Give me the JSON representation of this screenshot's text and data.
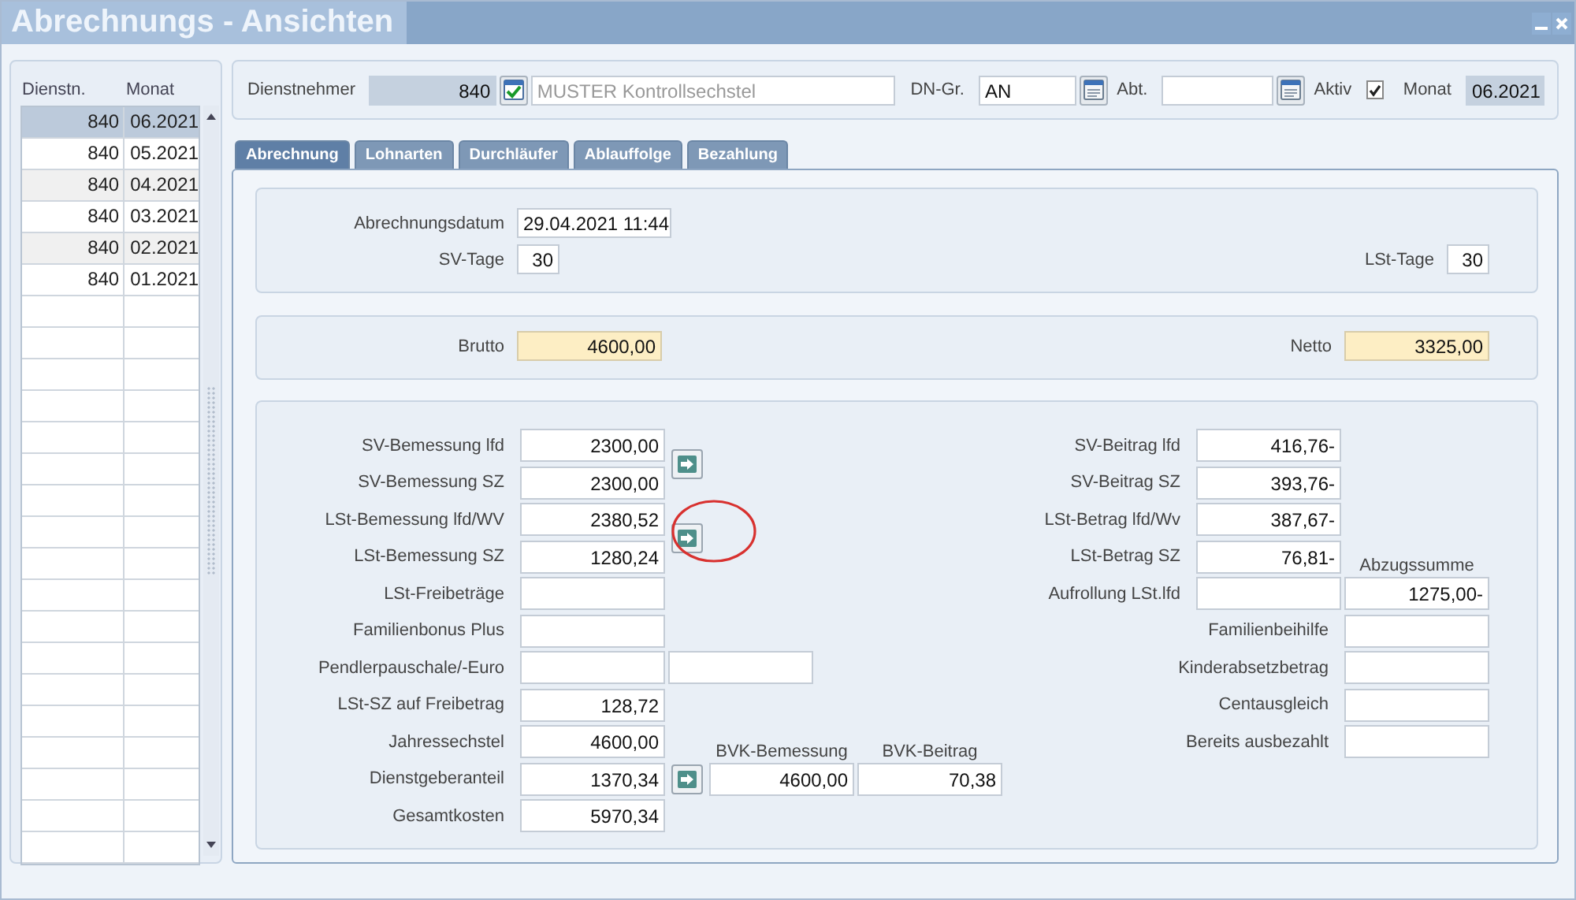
{
  "window": {
    "title": "Abrechnungs - Ansichten"
  },
  "list": {
    "columns": [
      "Dienstn.",
      "Monat"
    ],
    "rows": [
      {
        "number": "840",
        "month": "06.2021",
        "selected": true
      },
      {
        "number": "840",
        "month": "05.2021",
        "selected": false
      },
      {
        "number": "840",
        "month": "04.2021",
        "selected": false
      },
      {
        "number": "840",
        "month": "03.2021",
        "selected": false
      },
      {
        "number": "840",
        "month": "02.2021",
        "selected": false
      },
      {
        "number": "840",
        "month": "01.2021",
        "selected": false
      }
    ]
  },
  "header": {
    "employee_label": "Dienstnehmer",
    "employee_number": "840",
    "employee_name": "MUSTER Kontrollsechstel",
    "group_label": "DN-Gr.",
    "group_value": "AN",
    "dept_label": "Abt.",
    "active_label": "Aktiv",
    "active_checked": true,
    "month_label": "Monat",
    "month_value": "06.2021"
  },
  "tabs": [
    {
      "label": "Abrechnung",
      "selected": true
    },
    {
      "label": "Lohnarten",
      "selected": false
    },
    {
      "label": "Durchläufer",
      "selected": false
    },
    {
      "label": "Ablauffolge",
      "selected": false
    },
    {
      "label": "Bezahlung",
      "selected": false
    }
  ],
  "dates": {
    "date_label": "Abrechnungsdatum",
    "date_value": "29.04.2021 11:44",
    "sv_days_label": "SV-Tage",
    "sv_days": "30",
    "lst_days_label": "LSt-Tage",
    "lst_days": "30"
  },
  "totals": {
    "gross_label": "Brutto",
    "gross": "4600,00",
    "net_label": "Netto",
    "net": "3325,00"
  },
  "rows": [
    {
      "label": "SV-Bemessung lfd",
      "value": "2300,00",
      "arrow": {
        "kind": "between"
      },
      "right": {
        "kind": "main",
        "label": "SV-Beitrag lfd",
        "value": "416,76-"
      }
    },
    {
      "label": "SV-Bemessung SZ",
      "value": "2300,00",
      "right": {
        "kind": "main",
        "label": "SV-Beitrag SZ",
        "value": "393,76-"
      }
    },
    {
      "label": "LSt-Bemessung lfd/WV",
      "value": "2380,52",
      "arrow": {
        "kind": "between",
        "highlighted": true
      },
      "right": {
        "kind": "main",
        "label": "LSt-Betrag lfd/Wv",
        "value": "387,67-"
      }
    },
    {
      "label": "LSt-Bemessung SZ",
      "value": "1280,24",
      "right": {
        "kind": "main",
        "label": "LSt-Betrag SZ",
        "value": "76,81-",
        "header": "Abzugssumme"
      }
    },
    {
      "label": "LSt-Freibeträge",
      "right": {
        "kind": "total",
        "label": "Aufrollung LSt.lfd",
        "value": "1275,00-"
      }
    },
    {
      "label": "Familienbonus Plus",
      "right": {
        "kind": "side",
        "label": "Familienbeihilfe"
      }
    },
    {
      "label": "Pendlerpauschale/-Euro",
      "extra_field": true,
      "right": {
        "kind": "side",
        "label": "Kinderabsetzbetrag"
      }
    },
    {
      "label": "LSt-SZ auf Freibetrag",
      "value": "128,72",
      "right": {
        "kind": "side",
        "label": "Centausgleich"
      }
    },
    {
      "label": "Jahressechstel",
      "value": "4600,00",
      "side_headers": [
        "BVK-Bemessung",
        "BVK-Beitrag"
      ],
      "right": {
        "kind": "side",
        "label": "Bereits ausbezahlt"
      }
    },
    {
      "label": "Dienstgeberanteil",
      "value": "1370,34",
      "arrow": {
        "kind": "inline"
      },
      "side_values": [
        "4600,00",
        "70,38"
      ]
    },
    {
      "label": "Gesamtkosten",
      "value": "5970,34"
    }
  ]
}
